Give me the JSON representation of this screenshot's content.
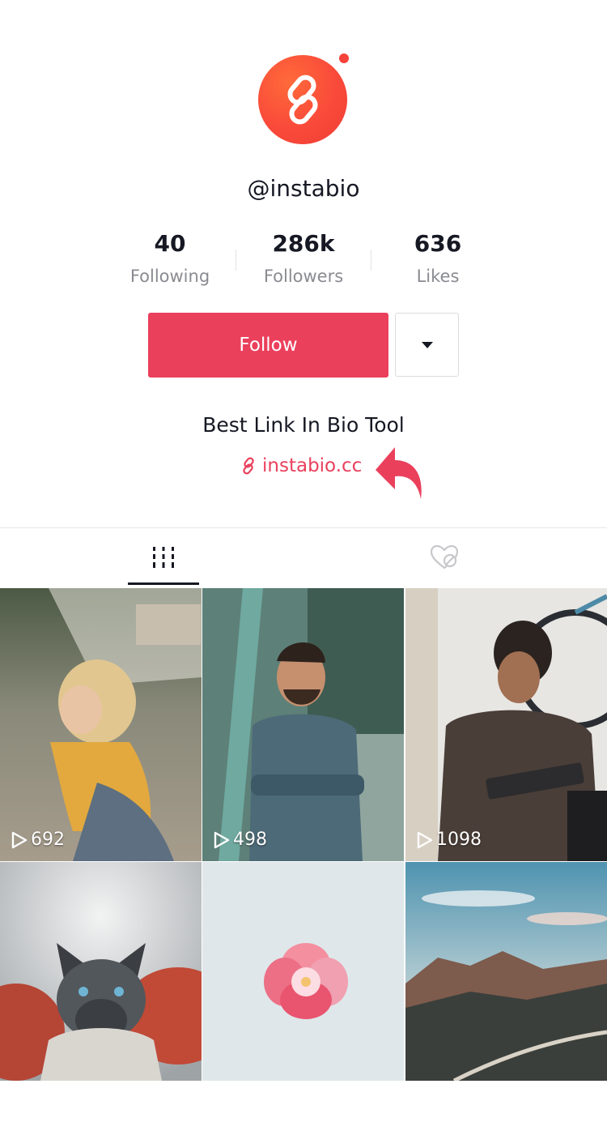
{
  "profile": {
    "username": "@instabio",
    "bio": "Best Link In Bio Tool",
    "link": "instabio.cc",
    "colors": {
      "accent": "#ea405c",
      "avatar": "#f94a3a"
    }
  },
  "stats": [
    {
      "value": "40",
      "label": "Following"
    },
    {
      "value": "286k",
      "label": "Followers"
    },
    {
      "value": "636",
      "label": "Likes"
    }
  ],
  "actions": {
    "follow_label": "Follow",
    "more_icon": "caret-down-icon"
  },
  "tabs": [
    {
      "name": "videos",
      "icon": "grid-bars-icon",
      "active": true
    },
    {
      "name": "liked",
      "icon": "hidden-heart-icon",
      "active": false
    }
  ],
  "videos": [
    {
      "views": "692"
    },
    {
      "views": "498"
    },
    {
      "views": "1098"
    },
    {
      "views": ""
    },
    {
      "views": ""
    },
    {
      "views": ""
    }
  ]
}
